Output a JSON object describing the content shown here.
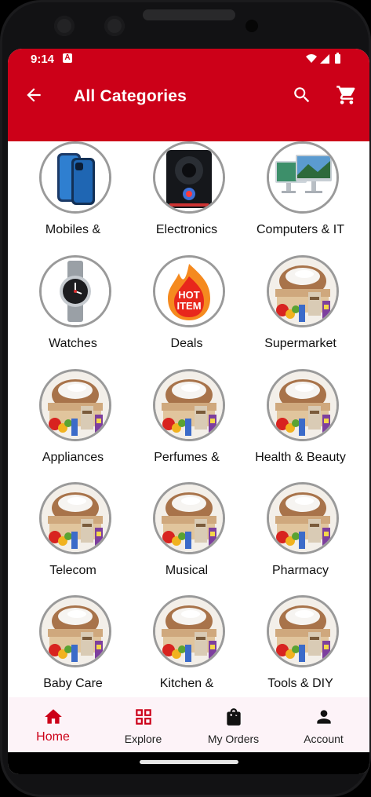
{
  "status_bar": {
    "time": "9:14",
    "notification_icon": "A"
  },
  "app_bar": {
    "title": "All Categories",
    "back_icon": "arrow-left-icon",
    "search_icon": "search-icon",
    "cart_icon": "shopping-cart-icon"
  },
  "colors": {
    "brand": "#cc0018",
    "nav_background": "#fdf3f8",
    "circle_border": "#9a9a9a"
  },
  "categories": [
    {
      "label": "Mobiles &",
      "image": "smartphones"
    },
    {
      "label": "Electronics",
      "image": "speaker-system"
    },
    {
      "label": "Computers & IT",
      "image": "desktop-computers"
    },
    {
      "label": "Watches",
      "image": "wristwatch"
    },
    {
      "label": "Deals",
      "image": "hot-item-flame",
      "image_text_1": "HOT",
      "image_text_2": "ITEM"
    },
    {
      "label": "Supermarket",
      "image": "grocery-basket"
    },
    {
      "label": "Appliances",
      "image": "grocery-basket"
    },
    {
      "label": "Perfumes &",
      "image": "grocery-basket"
    },
    {
      "label": "Health & Beauty",
      "image": "grocery-basket"
    },
    {
      "label": "Telecom",
      "image": "grocery-basket"
    },
    {
      "label": "Musical",
      "image": "grocery-basket"
    },
    {
      "label": "Pharmacy",
      "image": "grocery-basket"
    },
    {
      "label": "Baby Care",
      "image": "grocery-basket"
    },
    {
      "label": "Kitchen &",
      "image": "grocery-basket"
    },
    {
      "label": "Tools & DIY",
      "image": "grocery-basket"
    }
  ],
  "bottom_nav": [
    {
      "label": "Home",
      "icon": "home-icon",
      "active": true
    },
    {
      "label": "Explore",
      "icon": "grid-icon",
      "active": false
    },
    {
      "label": "My Orders",
      "icon": "shopping-bag-icon",
      "active": false
    },
    {
      "label": "Account",
      "icon": "person-icon",
      "active": false
    }
  ]
}
